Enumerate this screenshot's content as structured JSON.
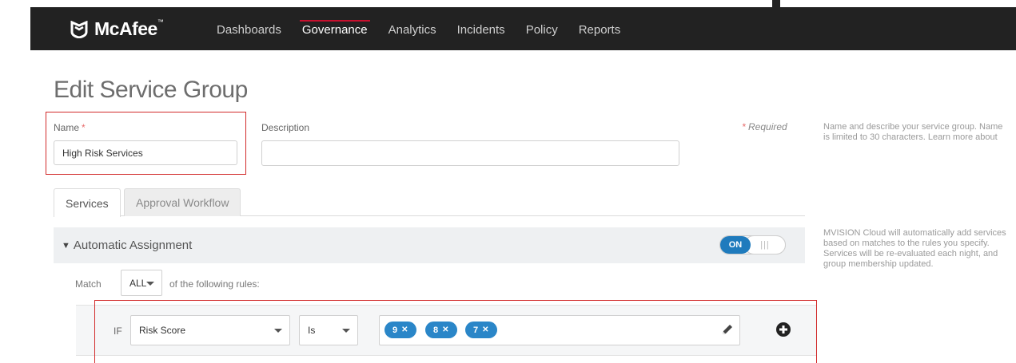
{
  "brand": {
    "name": "McAfee",
    "trademark": "™"
  },
  "nav": {
    "items": [
      {
        "label": "Dashboards",
        "active": false
      },
      {
        "label": "Governance",
        "active": true
      },
      {
        "label": "Analytics",
        "active": false
      },
      {
        "label": "Incidents",
        "active": false
      },
      {
        "label": "Policy",
        "active": false
      },
      {
        "label": "Reports",
        "active": false
      }
    ]
  },
  "page": {
    "title": "Edit Service Group"
  },
  "form": {
    "name_label": "Name",
    "required_star": "*",
    "name_value": "High Risk Services",
    "description_label": "Description",
    "description_value": "",
    "required_note": "Required"
  },
  "help": {
    "name_help": "Name and describe your service group. Name is limited to 30 characters. Learn more about",
    "auto_help": "MVISION Cloud will automatically add services based on matches to the rules you specify. Services will be re-evaluated each night, and group membership updated."
  },
  "tabs": [
    {
      "label": "Services",
      "active": true
    },
    {
      "label": "Approval Workflow",
      "active": false
    }
  ],
  "auto_assignment": {
    "title": "Automatic Assignment",
    "toggle_label": "ON",
    "toggle_grip": "|||",
    "enabled": true
  },
  "match": {
    "prefix": "Match",
    "value": "ALL",
    "suffix": "of the following rules:"
  },
  "rule": {
    "if_label": "IF",
    "field": "Risk Score",
    "operator": "Is",
    "values": [
      "9",
      "8",
      "7"
    ]
  },
  "colors": {
    "nav_bg": "#222222",
    "accent_red": "#c8102e",
    "tag_blue": "#2a86c8",
    "toggle_blue": "#1f7bbd",
    "highlight_outline": "#d22a2a"
  },
  "icons": {
    "brand": "mcafee-shield-icon",
    "edit": "pencil-icon",
    "add": "plus-circle-icon",
    "collapse": "caret-down-icon",
    "remove_tag": "close-icon"
  }
}
